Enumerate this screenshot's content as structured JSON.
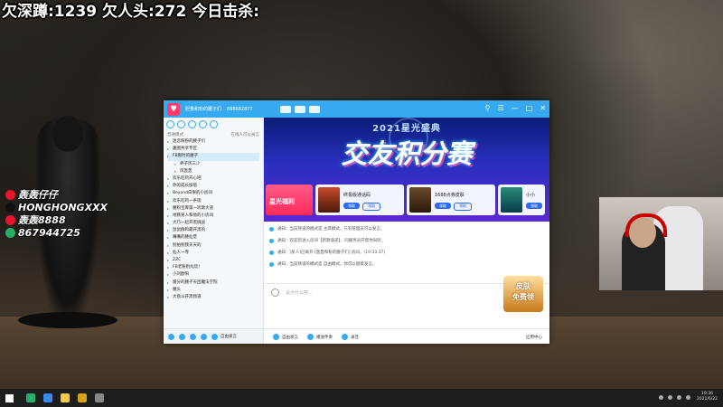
{
  "overlay": {
    "stats_text": "欠深蹲:1239 欠人头:272 今日击杀:"
  },
  "social": [
    {
      "icon": "weibo-icon",
      "color": "#e6162d",
      "text": "轰轰仔仔"
    },
    {
      "icon": "tiktok-icon",
      "color": "#111111",
      "text": "HONGHONGXXX"
    },
    {
      "icon": "weibo-icon",
      "color": "#e6162d",
      "text": "轰轰8888"
    },
    {
      "icon": "wechat-icon",
      "color": "#2aae67",
      "text": "867944725"
    }
  ],
  "window": {
    "title": "胆量和粉的腰子们",
    "title_id": "868682877",
    "controls": [
      "⚲",
      "☰",
      "—",
      "□",
      "✕"
    ]
  },
  "sidebar": {
    "mode_label": "普通模式",
    "online_label": "在线人可以发言",
    "items": [
      {
        "label": "迷恋粉粉的腰子们",
        "selected": false,
        "sub": false
      },
      {
        "label": "趣图共享专区",
        "selected": false,
        "sub": false
      },
      {
        "label": "FB限时的腰子",
        "selected": true,
        "sub": false
      },
      {
        "label": "养子风三少",
        "selected": false,
        "sub": true
      },
      {
        "label": "风轰轰",
        "selected": false,
        "sub": true
      },
      {
        "label": "欢乐吃鸡开心吧",
        "selected": false,
        "sub": false
      },
      {
        "label": "你的成长加倍",
        "selected": false,
        "sub": false
      },
      {
        "label": "Beyond白果的小房间",
        "selected": false,
        "sub": false
      },
      {
        "label": "欢乐吃鸡一条街",
        "selected": false,
        "sub": false
      },
      {
        "label": "腰粉宝库第一听歌大道",
        "selected": false,
        "sub": false
      },
      {
        "label": "地铁男人和他的小房间",
        "selected": false,
        "sub": false
      },
      {
        "label": "大乃一起开黑挑战",
        "selected": false,
        "sub": false
      },
      {
        "label": "鼠鼠群和最开黑的",
        "selected": false,
        "sub": false
      },
      {
        "label": "嘴嘴的腰仙堡",
        "selected": false,
        "sub": false
      },
      {
        "label": "别拍别我天天的",
        "selected": false,
        "sub": false
      },
      {
        "label": "仙人一寺",
        "selected": false,
        "sub": false
      },
      {
        "label": "ZZC",
        "selected": false,
        "sub": false
      },
      {
        "label": "FB老粉别丸玩！",
        "selected": false,
        "sub": false
      },
      {
        "label": "小刘欧阳",
        "selected": false,
        "sub": false
      },
      {
        "label": "蹭分的腰子天团魔法学院",
        "selected": false,
        "sub": false
      },
      {
        "label": "腰头",
        "selected": false,
        "sub": false
      },
      {
        "label": "大盘斗开黑频道",
        "selected": false,
        "sub": false
      }
    ],
    "bottom_label": "自由发言"
  },
  "banner": {
    "top_text": "2021星光盛典",
    "main_text": "交友积分赛",
    "cards": [
      {
        "name": "星光福利",
        "first": true
      },
      {
        "name": "终极版通话码",
        "btn1": "领取",
        "btn2": "领取"
      },
      {
        "name": "1688点券皮肤",
        "btn1": "领取",
        "btn2": "领取"
      },
      {
        "name": "小小",
        "btn1": "领取",
        "btn2": ""
      }
    ]
  },
  "messages": [
    "通知：当前频道的模式是 主席模式，只有管理员可以发言。",
    "通知：欢迎您进入房间【新歌速递】，同服务员开帮你同听。",
    "通知：[新人]已离开 [轰轰和粉的腰子们] 房间。(19:33:37)",
    "通知：当前频道的模式是 自由模式，你可以随意发言。"
  ],
  "promo": {
    "line1": "皮肤",
    "line2": "免费领"
  },
  "input": {
    "placeholder": "说点什么吧..."
  },
  "bottom_bar": {
    "items": [
      "自由发言",
      "播放伴奏",
      "录音"
    ],
    "right": "应用中心"
  },
  "taskbar": {
    "icons": [
      {
        "name": "wechat-icon",
        "color": "#2aae67"
      },
      {
        "name": "messenger-icon",
        "color": "#3b8beb"
      },
      {
        "name": "folder-icon",
        "color": "#f2c94c"
      },
      {
        "name": "app-icon",
        "color": "#d4a017"
      },
      {
        "name": "media-icon",
        "color": "#888888"
      }
    ],
    "time": "19:36",
    "date": "2021/6/22"
  }
}
